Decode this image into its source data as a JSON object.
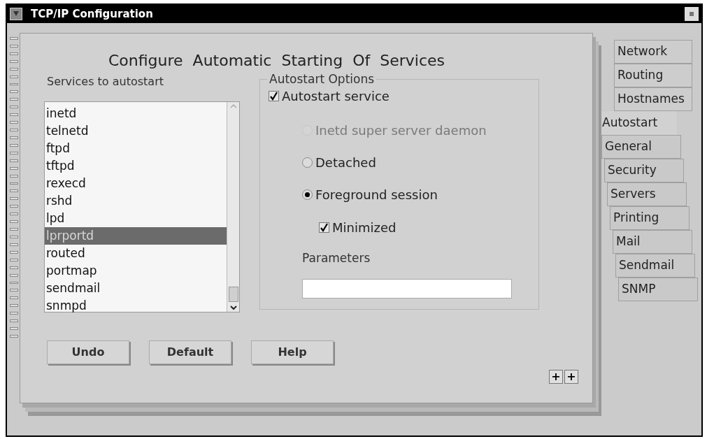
{
  "window": {
    "title": "TCP/IP Configuration"
  },
  "page": {
    "heading": "Configure  Automatic  Starting  Of  Services"
  },
  "services": {
    "label": "Services to autostart",
    "items": [
      {
        "name": "inetd",
        "selected": false
      },
      {
        "name": "telnetd",
        "selected": false
      },
      {
        "name": "ftpd",
        "selected": false
      },
      {
        "name": "tftpd",
        "selected": false
      },
      {
        "name": "rexecd",
        "selected": false
      },
      {
        "name": "rshd",
        "selected": false
      },
      {
        "name": "lpd",
        "selected": false
      },
      {
        "name": "lprportd",
        "selected": true
      },
      {
        "name": "routed",
        "selected": false
      },
      {
        "name": "portmap",
        "selected": false
      },
      {
        "name": "sendmail",
        "selected": false
      },
      {
        "name": "snmpd",
        "selected": false
      }
    ]
  },
  "options": {
    "title": "Autostart Options",
    "autostart": {
      "label": "Autostart service",
      "checked": true
    },
    "modes": [
      {
        "label": "Inetd super server daemon",
        "selected": false,
        "disabled": true
      },
      {
        "label": "Detached",
        "selected": false,
        "disabled": false
      },
      {
        "label": "Foreground session",
        "selected": true,
        "disabled": false
      }
    ],
    "minimized": {
      "label": "Minimized",
      "checked": true
    },
    "parameters": {
      "label": "Parameters"
    }
  },
  "buttons": [
    "Undo",
    "Default",
    "Help"
  ],
  "page_arrows": [
    "+",
    "+"
  ],
  "tabs": [
    {
      "label": "Network",
      "back_row": true,
      "selected": false
    },
    {
      "label": "Routing",
      "back_row": true,
      "selected": false
    },
    {
      "label": "Hostnames",
      "back_row": true,
      "selected": false
    },
    {
      "label": "Autostart",
      "back_row": false,
      "selected": true
    },
    {
      "label": "General",
      "back_row": false,
      "selected": false
    },
    {
      "label": "Security",
      "back_row": false,
      "selected": false
    },
    {
      "label": "Servers",
      "back_row": false,
      "selected": false
    },
    {
      "label": "Printing",
      "back_row": false,
      "selected": false
    },
    {
      "label": "Mail",
      "back_row": false,
      "selected": false
    },
    {
      "label": "Sendmail",
      "back_row": false,
      "selected": false
    },
    {
      "label": "SNMP",
      "back_row": false,
      "selected": false
    }
  ]
}
